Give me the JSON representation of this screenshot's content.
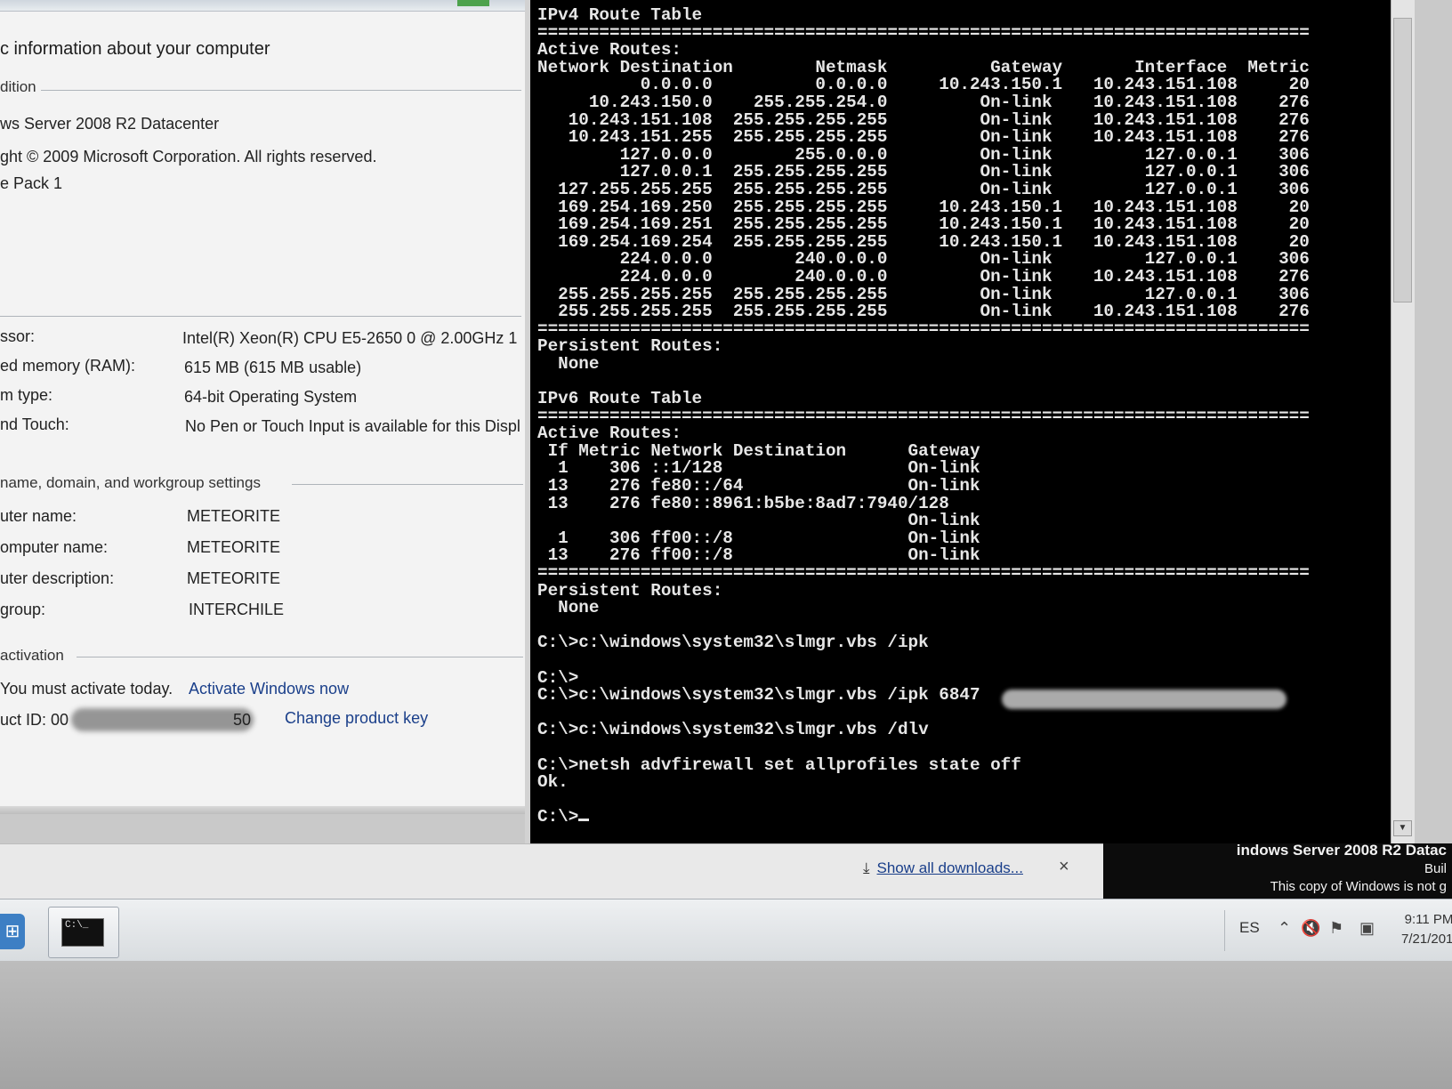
{
  "system_properties": {
    "heading": "c information about your computer",
    "edition_section": "dition",
    "os_name": "ws Server 2008 R2 Datacenter",
    "copyright": "ght © 2009 Microsoft Corporation.  All rights reserved.",
    "service_pack": "e Pack 1",
    "rows": [
      {
        "label": "ssor:",
        "value": "Intel(R) Xeon(R) CPU E5-2650 0 @ 2.00GHz   1"
      },
      {
        "label": "ed memory (RAM):",
        "value": "615 MB (615 MB usable)"
      },
      {
        "label": "m type:",
        "value": "64-bit Operating System"
      },
      {
        "label": "nd Touch:",
        "value": "No Pen or Touch Input is available for this Displ"
      }
    ],
    "computer_section": "name, domain, and workgroup settings",
    "computer_rows": [
      {
        "label": "uter name:",
        "value": "METEORITE"
      },
      {
        "label": "omputer name:",
        "value": "METEORITE"
      },
      {
        "label": "uter description:",
        "value": "METEORITE"
      },
      {
        "label": "group:",
        "value": "INTERCHILE"
      }
    ],
    "activation_section": "activation",
    "activation_text": "You must activate today.",
    "activate_link": "Activate Windows now",
    "product_id_label": "uct ID: 00",
    "product_id_tail": "50",
    "change_key_link": "Change product key"
  },
  "console": {
    "text": "IPv4 Route Table\n===========================================================================\nActive Routes:\nNetwork Destination        Netmask          Gateway       Interface  Metric\n          0.0.0.0          0.0.0.0     10.243.150.1   10.243.151.108     20\n     10.243.150.0    255.255.254.0         On-link    10.243.151.108    276\n   10.243.151.108  255.255.255.255         On-link    10.243.151.108    276\n   10.243.151.255  255.255.255.255         On-link    10.243.151.108    276\n        127.0.0.0        255.0.0.0         On-link         127.0.0.1    306\n        127.0.0.1  255.255.255.255         On-link         127.0.0.1    306\n  127.255.255.255  255.255.255.255         On-link         127.0.0.1    306\n  169.254.169.250  255.255.255.255     10.243.150.1   10.243.151.108     20\n  169.254.169.251  255.255.255.255     10.243.150.1   10.243.151.108     20\n  169.254.169.254  255.255.255.255     10.243.150.1   10.243.151.108     20\n        224.0.0.0        240.0.0.0         On-link         127.0.0.1    306\n        224.0.0.0        240.0.0.0         On-link    10.243.151.108    276\n  255.255.255.255  255.255.255.255         On-link         127.0.0.1    306\n  255.255.255.255  255.255.255.255         On-link    10.243.151.108    276\n===========================================================================\nPersistent Routes:\n  None\n\nIPv6 Route Table\n===========================================================================\nActive Routes:\n If Metric Network Destination      Gateway\n  1    306 ::1/128                  On-link\n 13    276 fe80::/64                On-link\n 13    276 fe80::8961:b5be:8ad7:7940/128\n                                    On-link\n  1    306 ff00::/8                 On-link\n 13    276 ff00::/8                 On-link\n===========================================================================\nPersistent Routes:\n  None\n\nC:\\>c:\\windows\\system32\\slmgr.vbs /ipk\n\nC:\\>\nC:\\>c:\\windows\\system32\\slmgr.vbs /ipk 6847",
    "text_after": "\n\nC:\\>c:\\windows\\system32\\slmgr.vbs /dlv\n\nC:\\>netsh advfirewall set allprofiles state off\nOk.\n\n",
    "prompt": "C:\\>"
  },
  "download_bar": {
    "link": "Show all downloads...",
    "close": "×"
  },
  "desktop": {
    "line1": "indows Server 2008 R2 Datac",
    "line2": "Buil",
    "line3": "This copy of Windows is not g"
  },
  "taskbar": {
    "start_icon": "windows-start-icon",
    "cmd_icon_text": "C:\\_",
    "language": "ES",
    "time": "9:11 PM",
    "date": "7/21/201"
  }
}
